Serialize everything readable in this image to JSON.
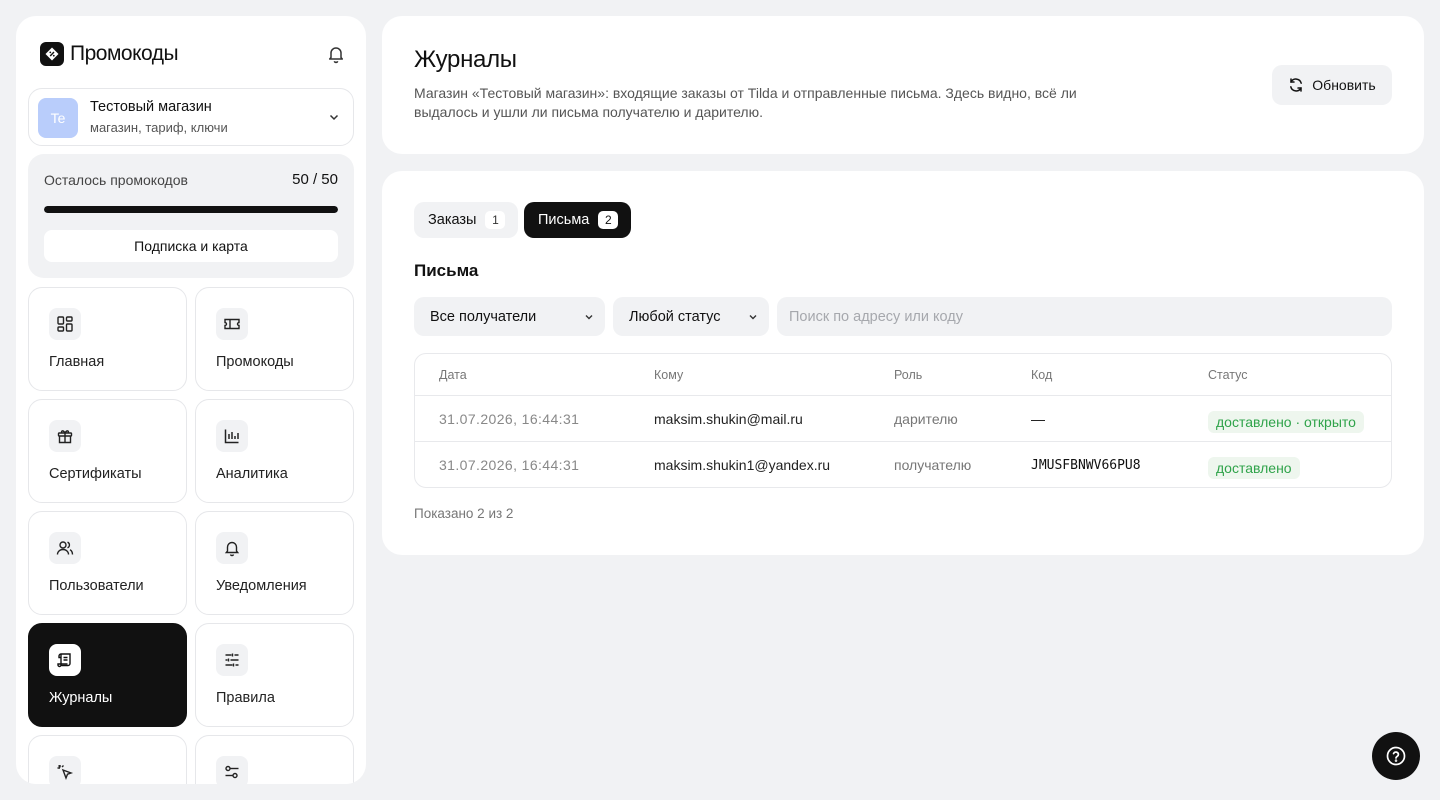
{
  "brand": {
    "name": "Промокоды"
  },
  "shop": {
    "avatar": "Te",
    "name": "Тестовый магазин",
    "subtitle": "магазин, тариф, ключи"
  },
  "quota": {
    "label": "Осталось промокодов",
    "value": "50 / 50",
    "fraction": 1.0,
    "button": "Подписка и карта"
  },
  "nav": {
    "items": [
      {
        "label": "Главная",
        "icon": "dashboard-icon"
      },
      {
        "label": "Промокоды",
        "icon": "ticket-icon"
      },
      {
        "label": "Сертификаты",
        "icon": "gift-icon"
      },
      {
        "label": "Аналитика",
        "icon": "bar-chart-icon"
      },
      {
        "label": "Пользователи",
        "icon": "users-icon"
      },
      {
        "label": "Уведомления",
        "icon": "bell-icon"
      },
      {
        "label": "Журналы",
        "icon": "scroll-icon",
        "active": true
      },
      {
        "label": "Правила",
        "icon": "sliders-icon"
      },
      {
        "label": "",
        "icon": "cursor-click-icon"
      },
      {
        "label": "",
        "icon": "settings-icon"
      }
    ]
  },
  "header": {
    "title": "Журналы",
    "description": "Магазин «Тестовый магазин»: входящие заказы от Tilda и отправленные письма. Здесь видно, всё ли выдалось и ушли ли письма получателю и дарителю.",
    "refresh": "Обновить"
  },
  "tabs": [
    {
      "label": "Заказы",
      "count": "1"
    },
    {
      "label": "Письма",
      "count": "2",
      "active": true
    }
  ],
  "section": {
    "title": "Письма"
  },
  "filters": {
    "recipient": "Все получатели",
    "status": "Любой статус",
    "search_placeholder": "Поиск по адресу или коду"
  },
  "table": {
    "columns": [
      "Дата",
      "Кому",
      "Роль",
      "Код",
      "Статус"
    ],
    "rows": [
      {
        "date": "31.07.2026, 16:44:31",
        "to": "maksim.shukin@mail.ru",
        "role": "дарителю",
        "code": "—",
        "status": "доставлено · открыто"
      },
      {
        "date": "31.07.2026, 16:44:31",
        "to": "maksim.shukin1@yandex.ru",
        "role": "получателю",
        "code": "JMUSFBNWV66PU8",
        "status": "доставлено"
      }
    ]
  },
  "footer": {
    "shown": "Показано 2 из 2"
  },
  "colors": {
    "accent": "#111111",
    "background": "#f1f2f4",
    "success": "#2fa34a",
    "avatar": "#b9cdfb"
  }
}
